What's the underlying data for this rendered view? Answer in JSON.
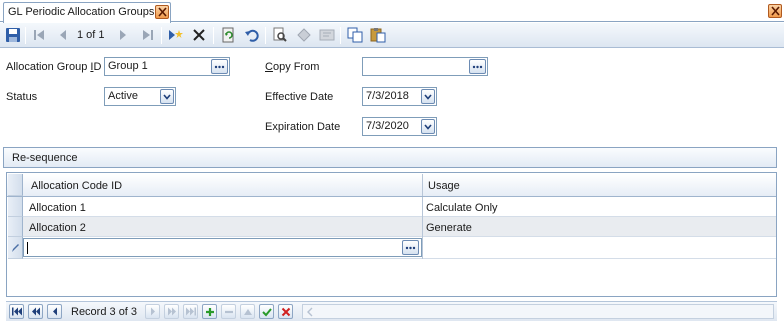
{
  "tab": {
    "title": "GL Periodic Allocation Groups"
  },
  "toolbar": {
    "record_position": "1 of 1"
  },
  "form": {
    "allocation_group_id": {
      "label_pre": "Allocation Group ",
      "label_u": "I",
      "label_post": "D",
      "value": "Group 1"
    },
    "copy_from": {
      "label_u": "C",
      "label_post": "opy From",
      "value": ""
    },
    "status": {
      "label": "Status",
      "value": "Active"
    },
    "effective_date": {
      "label": "Effective Date",
      "value": "7/3/2018"
    },
    "expiration_date": {
      "label": "Expiration Date",
      "value": "7/3/2020"
    }
  },
  "resequence": {
    "label": "Re-sequence"
  },
  "grid": {
    "columns": [
      "Allocation Code ID",
      "Usage"
    ],
    "rows": [
      {
        "allocation_code_id": "Allocation 1",
        "usage": "Calculate Only"
      },
      {
        "allocation_code_id": "Allocation 2",
        "usage": "Generate"
      }
    ]
  },
  "navigator": {
    "record_text": "Record 3 of 3"
  },
  "colors": {
    "accent": "#8aa4c2",
    "close_orange": "#f19b4c",
    "add_green": "#2a9a2a",
    "cancel_red": "#d02020"
  }
}
